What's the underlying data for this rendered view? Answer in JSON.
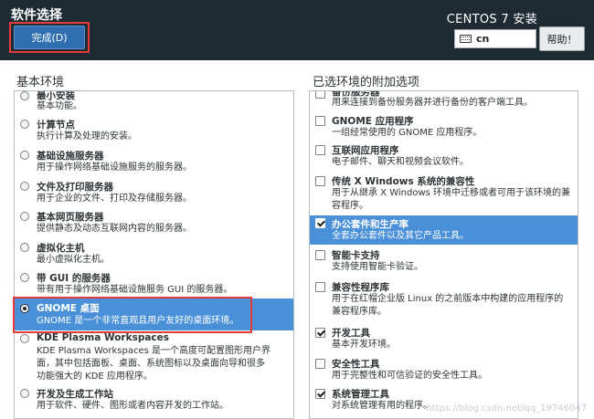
{
  "header": {
    "title": "软件选择",
    "done_label": "完成(D)",
    "product_title": "CENTOS 7 安装",
    "keyboard_layout": "cn",
    "help_label": "帮助！"
  },
  "left": {
    "section_title": "基本环境",
    "items": [
      {
        "title": "最小安装",
        "desc": "基本功能。",
        "selected": false
      },
      {
        "title": "计算节点",
        "desc": "执行计算及处理的安装。",
        "selected": false
      },
      {
        "title": "基础设施服务器",
        "desc": "用于操作网络基础设施服务的服务器。",
        "selected": false
      },
      {
        "title": "文件及打印服务器",
        "desc": "用于企业的文件、打印及存储服务器。",
        "selected": false
      },
      {
        "title": "基本网页服务器",
        "desc": "提供静态及动态互联网内容的服务器。",
        "selected": false
      },
      {
        "title": "虚拟化主机",
        "desc": "最小虚拟化主机。",
        "selected": false
      },
      {
        "title": "带 GUI 的服务器",
        "desc": "带有用于操作网络基础设施服务 GUI 的服务器。",
        "selected": false
      },
      {
        "title": "GNOME 桌面",
        "desc": "GNOME 是一个非常直观且用户友好的桌面环境。",
        "selected": true
      },
      {
        "title": "KDE Plasma Workspaces",
        "desc1": "KDE Plasma Workspaces 是一个高度可配置图形用户界",
        "desc2": "面，其中包括面板、桌面、系统图标以及桌面向导和很多",
        "desc3": "功能强大的 KDE 应用程序。",
        "selected": false
      },
      {
        "title": "开发及生成工作站",
        "desc": "用于软件、硬件、图形或者内容开发的工作站。",
        "selected": false
      }
    ]
  },
  "right": {
    "section_title": "已选环境的附加选项",
    "items": [
      {
        "title": "备份服务器",
        "desc": "用来连接到备份服务器并进行备份的客户端工具。",
        "checked": false
      },
      {
        "title": "GNOME 应用程序",
        "desc": "一组经常使用的 GNOME 应用程序。",
        "checked": false
      },
      {
        "title": "互联网应用程序",
        "desc": "电子邮件、聊天和视频会议软件。",
        "checked": false
      },
      {
        "title": "传统 X Windows 系统的兼容性",
        "desc1": "用于从继承 X Windows 环境中迁移或者可用于该环境的兼",
        "desc2": "容程序。",
        "checked": false
      },
      {
        "title": "办公套件和生产率",
        "desc": "全套办公套件以及其它产品工具。",
        "checked": true,
        "selected": true
      },
      {
        "title": "智能卡支持",
        "desc": "支持使用智能卡验证。",
        "checked": false
      },
      {
        "title": "兼容性程序库",
        "desc1": "用于在红帽企业版 Linux 的之前版本中构建的应用程序的",
        "desc2": "兼容程序库。",
        "checked": false
      },
      {
        "title": "开发工具",
        "desc": "基本开发环境。",
        "checked": true
      },
      {
        "title": "安全性工具",
        "desc": "用于完整性和可信验证的安全性工具。",
        "checked": false
      },
      {
        "title": "系统管理工具",
        "desc": "对系统管理有用的程序。",
        "checked": true
      }
    ]
  },
  "watermark": "https://blog.csdn.net/qq_19746047"
}
